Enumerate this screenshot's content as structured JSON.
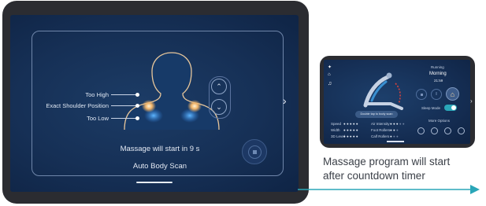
{
  "main_screen": {
    "level_labels": {
      "too_high": "Too High",
      "exact": "Exact Shoulder Position",
      "too_low": "Too Low"
    },
    "countdown_text": "Massage will start in 9 s",
    "mode_label": "Auto Body Scan"
  },
  "mini_screen": {
    "status": "Running",
    "mode": "Morning",
    "time": "21:59",
    "scan_button": "Double tap to body scan",
    "sleep_mode_label": "Sleep Mode",
    "more_options": "More Options",
    "settings_left": [
      {
        "label": "Speed",
        "level": 5,
        "max": 5
      },
      {
        "label": "Width",
        "level": 5,
        "max": 5
      },
      {
        "label": "3D Level",
        "level": 5,
        "max": 5
      }
    ],
    "settings_right": [
      {
        "label": "Air Intensity",
        "level": 3,
        "max": 5
      },
      {
        "label": "Foot Rollers",
        "level": 2,
        "max": 3
      },
      {
        "label": "Calf Rollers",
        "level": 1,
        "max": 3
      }
    ]
  },
  "caption": {
    "line1": "Massage program will start",
    "line2": "after countdown timer"
  },
  "colors": {
    "accent_teal": "#2aa6b8",
    "screen_blue": "#163056",
    "highlight_orange": "#f0b46a"
  }
}
